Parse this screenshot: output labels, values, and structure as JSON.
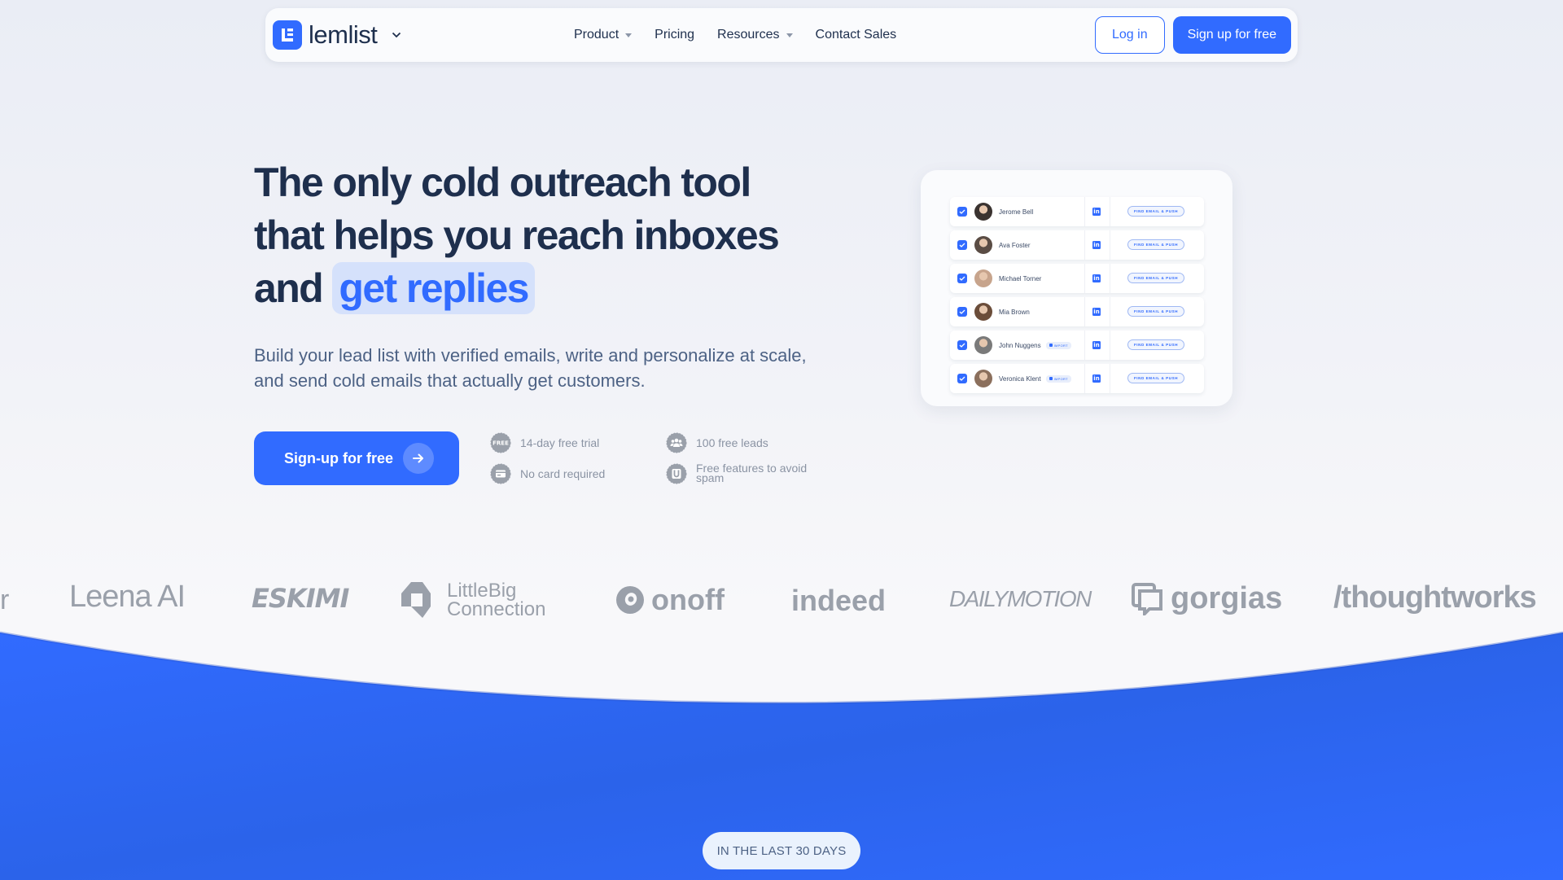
{
  "nav": {
    "brand": "lemlist",
    "links": [
      {
        "label": "Product",
        "has_dropdown": true
      },
      {
        "label": "Pricing",
        "has_dropdown": false
      },
      {
        "label": "Resources",
        "has_dropdown": true
      },
      {
        "label": "Contact Sales",
        "has_dropdown": false
      }
    ],
    "login_label": "Log in",
    "signup_label": "Sign up for free"
  },
  "hero": {
    "title_line1": "The only cold outreach tool",
    "title_line2": "that helps you reach inboxes",
    "title_line3_prefix": "and",
    "title_highlight": "get replies",
    "subtitle": "Build your lead list with verified emails, write and personalize at scale, and send cold emails that actually get customers.",
    "cta_label": "Sign-up for free",
    "perks": [
      {
        "icon": "free-badge-icon",
        "label": "14-day free trial"
      },
      {
        "icon": "card-icon",
        "label": "No card required"
      },
      {
        "icon": "users-icon",
        "label": "100 free leads"
      },
      {
        "icon": "magnet-icon",
        "label": "Free features to avoid spam"
      }
    ]
  },
  "leads": {
    "find_label": "FIND EMAIL & PUSH",
    "import_label": "IMPORT",
    "linkedin_label": "in",
    "rows": [
      {
        "name": "Jerome Bell",
        "checked": true,
        "import": false,
        "avatar_color": "#3a3330"
      },
      {
        "name": "Ava Foster",
        "checked": true,
        "import": false,
        "avatar_color": "#5a4c44"
      },
      {
        "name": "Michael Torner",
        "checked": true,
        "import": false,
        "avatar_color": "#c7a48c"
      },
      {
        "name": "Mia Brown",
        "checked": true,
        "import": false,
        "avatar_color": "#6b4d3a"
      },
      {
        "name": "John Nuggens",
        "checked": true,
        "import": true,
        "avatar_color": "#7a7a7a"
      },
      {
        "name": "Veronica Klent",
        "checked": true,
        "import": true,
        "avatar_color": "#8b6f5c"
      }
    ]
  },
  "logos": [
    "Leena AI",
    "ESKIMI",
    "LittleBig Connection",
    "onoff",
    "indeed",
    "DAILYMOTION",
    "gorgias",
    "/thoughtworks"
  ],
  "stats": {
    "pill_label": "IN THE LAST 30 DAYS"
  },
  "colors": {
    "brand_blue": "#316bff",
    "text_dark": "#1e2f4d",
    "text_muted": "#4d6285",
    "highlight_bg": "#d5e1fb",
    "logo_gray": "#9aa0aa"
  }
}
